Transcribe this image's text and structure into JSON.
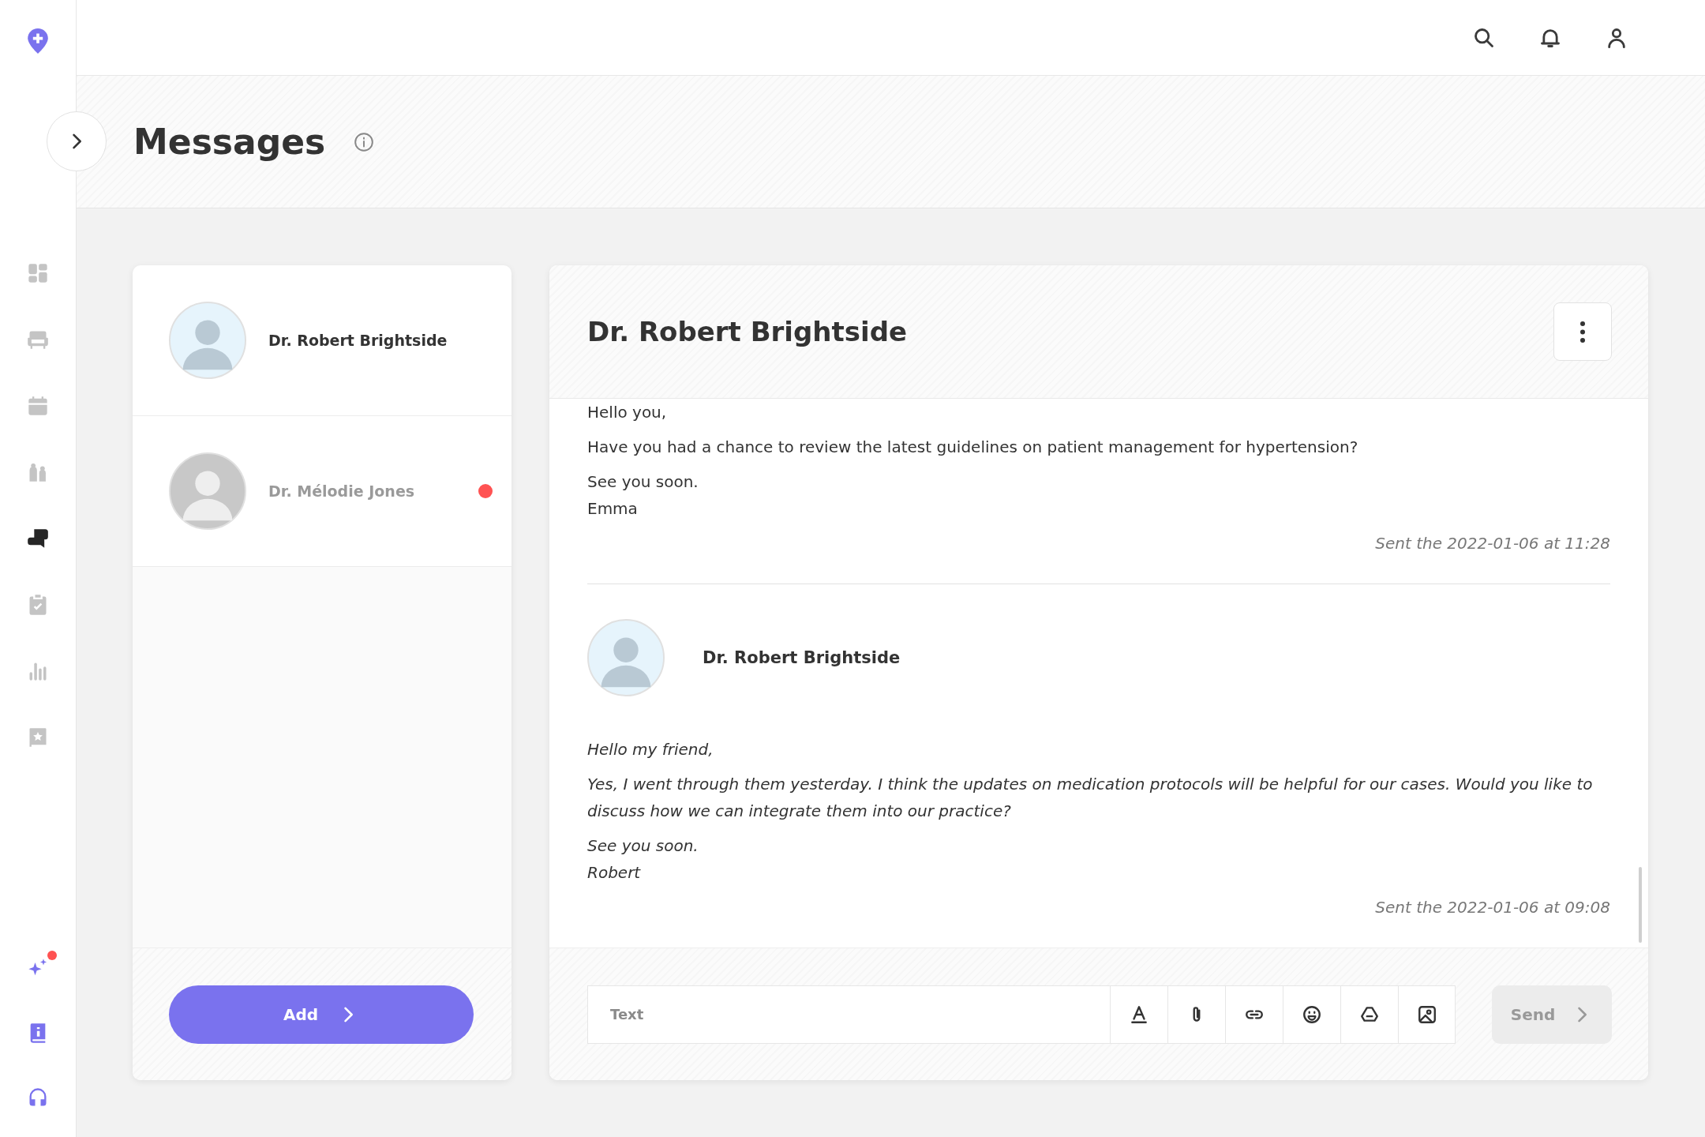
{
  "sidebar": {
    "nav": [
      {
        "selected": false
      },
      {
        "selected": false
      },
      {
        "selected": false
      },
      {
        "selected": false
      },
      {
        "selected": true
      },
      {
        "selected": false
      },
      {
        "selected": false
      },
      {
        "selected": false
      }
    ],
    "extras": [
      {
        "badge": true
      },
      {
        "badge": false
      },
      {
        "badge": false
      }
    ]
  },
  "page": {
    "title": "Messages"
  },
  "contacts": [
    {
      "name": "Dr. Robert Brightside",
      "selected": true,
      "unread": false
    },
    {
      "name": "Dr. Mélodie Jones",
      "selected": false,
      "unread": true
    }
  ],
  "add_button": "Add",
  "chat": {
    "title": "Dr. Robert Brightside",
    "messages": [
      {
        "kind": "incoming",
        "paragraphs": [
          [
            "Hello you,"
          ],
          [
            "Have you had a chance to review the latest guidelines on patient management for hypertension?"
          ],
          [
            "See you soon.",
            "Emma"
          ]
        ],
        "sent": "Sent the 2022-01-06 at 11:28"
      },
      {
        "kind": "outgoing",
        "author": "Dr. Robert Brightside",
        "paragraphs": [
          [
            "Hello my friend,"
          ],
          [
            "Yes, I went through them yesterday. I think the updates on medication protocols will be helpful for our cases. Would you like to discuss how we can integrate them into our practice?"
          ],
          [
            "See you soon.",
            "Robert"
          ]
        ],
        "sent": "Sent the 2022-01-06 at 09:08"
      }
    ]
  },
  "composer": {
    "placeholder": "Text",
    "send": {
      "label": "Send",
      "disabled": true
    }
  }
}
